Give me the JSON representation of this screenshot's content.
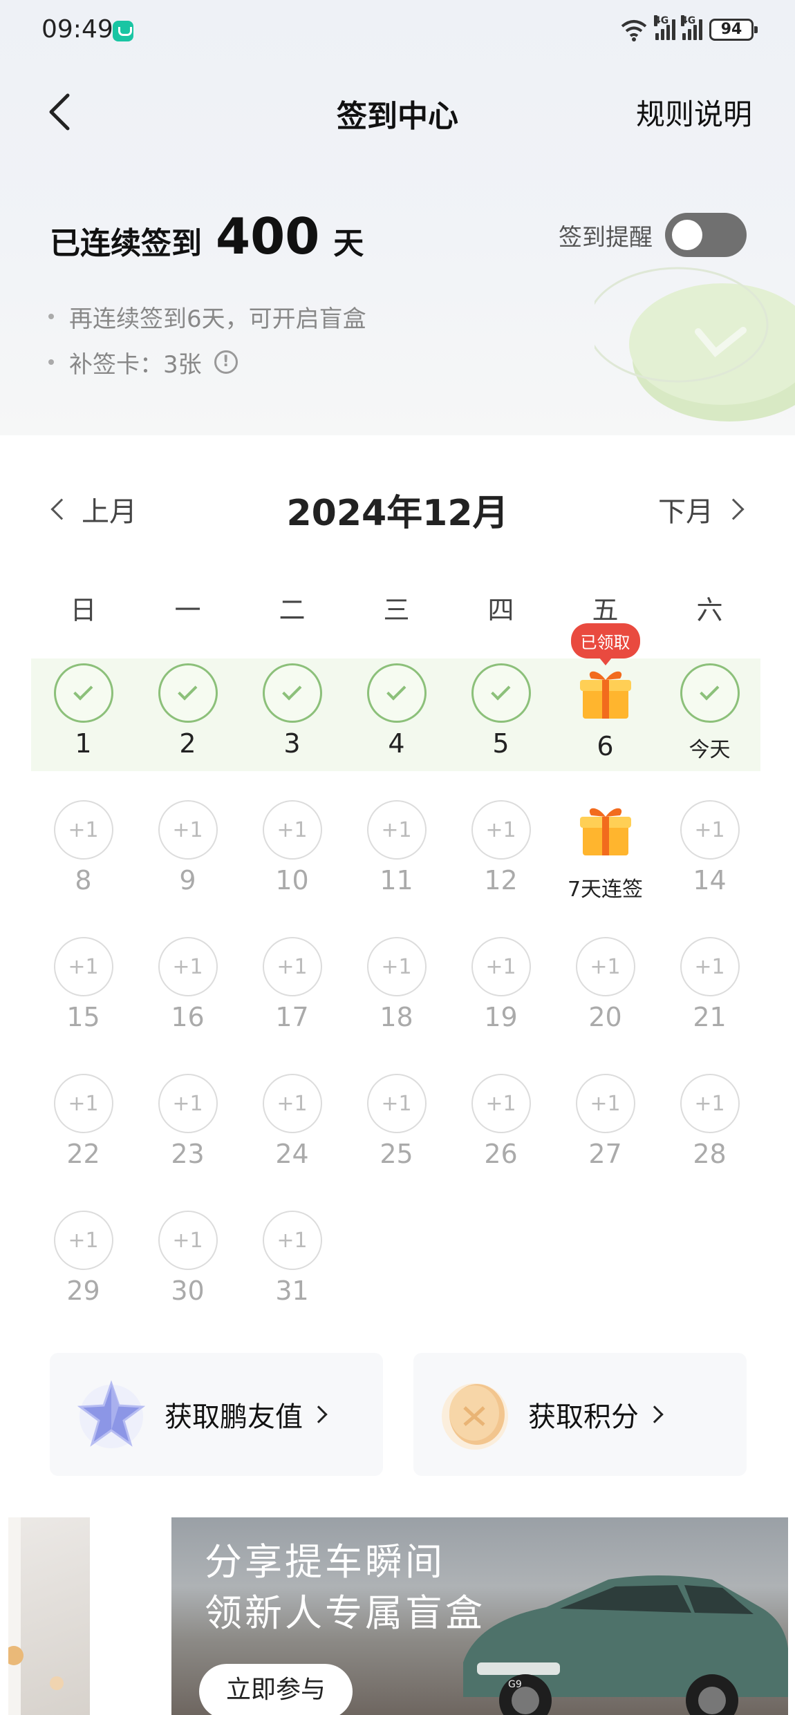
{
  "status_bar": {
    "time": "09:49",
    "signal_label": "6",
    "net1": "4G",
    "net2": "4G",
    "battery": "94"
  },
  "nav": {
    "title": "签到中心",
    "rules": "规则说明"
  },
  "streak": {
    "prefix": "已连续签到",
    "days": "400",
    "unit": "天",
    "reminder_label": "签到提醒",
    "reminder_on": false,
    "bullet_1": "再连续签到6天，可开启盲盒",
    "bullet_2": "补签卡：3张",
    "info_glyph": "!"
  },
  "calendar": {
    "prev_label": "上月",
    "title": "2024年12月",
    "next_label": "下月",
    "weekdays": [
      "日",
      "一",
      "二",
      "三",
      "四",
      "五",
      "六"
    ],
    "weeks": [
      [
        {
          "label": "1",
          "state": "checked"
        },
        {
          "label": "2",
          "state": "checked"
        },
        {
          "label": "3",
          "state": "checked"
        },
        {
          "label": "4",
          "state": "checked"
        },
        {
          "label": "5",
          "state": "checked"
        },
        {
          "label": "6",
          "state": "gift-claimed",
          "badge": "已领取"
        },
        {
          "label": "今天",
          "state": "checked-today"
        }
      ],
      [
        {
          "label": "8",
          "state": "pending",
          "reward": "+1"
        },
        {
          "label": "9",
          "state": "pending",
          "reward": "+1"
        },
        {
          "label": "10",
          "state": "pending",
          "reward": "+1"
        },
        {
          "label": "11",
          "state": "pending",
          "reward": "+1"
        },
        {
          "label": "12",
          "state": "pending",
          "reward": "+1"
        },
        {
          "label": "7天连签",
          "state": "gift"
        },
        {
          "label": "14",
          "state": "pending",
          "reward": "+1"
        }
      ],
      [
        {
          "label": "15",
          "state": "pending",
          "reward": "+1"
        },
        {
          "label": "16",
          "state": "pending",
          "reward": "+1"
        },
        {
          "label": "17",
          "state": "pending",
          "reward": "+1"
        },
        {
          "label": "18",
          "state": "pending",
          "reward": "+1"
        },
        {
          "label": "19",
          "state": "pending",
          "reward": "+1"
        },
        {
          "label": "20",
          "state": "pending",
          "reward": "+1"
        },
        {
          "label": "21",
          "state": "pending",
          "reward": "+1"
        }
      ],
      [
        {
          "label": "22",
          "state": "pending",
          "reward": "+1"
        },
        {
          "label": "23",
          "state": "pending",
          "reward": "+1"
        },
        {
          "label": "24",
          "state": "pending",
          "reward": "+1"
        },
        {
          "label": "25",
          "state": "pending",
          "reward": "+1"
        },
        {
          "label": "26",
          "state": "pending",
          "reward": "+1"
        },
        {
          "label": "27",
          "state": "pending",
          "reward": "+1"
        },
        {
          "label": "28",
          "state": "pending",
          "reward": "+1"
        }
      ],
      [
        {
          "label": "29",
          "state": "pending",
          "reward": "+1"
        },
        {
          "label": "30",
          "state": "pending",
          "reward": "+1"
        },
        {
          "label": "31",
          "state": "pending",
          "reward": "+1"
        }
      ]
    ]
  },
  "cards": {
    "friend_value": "获取鹏友值",
    "points": "获取积分"
  },
  "banner": {
    "line1": "分享提车瞬间",
    "line2": "领新人专属盲盒",
    "button": "立即参与",
    "car_plate": "G9"
  },
  "colors": {
    "check_green": "#8cc07a",
    "badge_red": "#e94a3f",
    "toggle_off": "#707070"
  }
}
